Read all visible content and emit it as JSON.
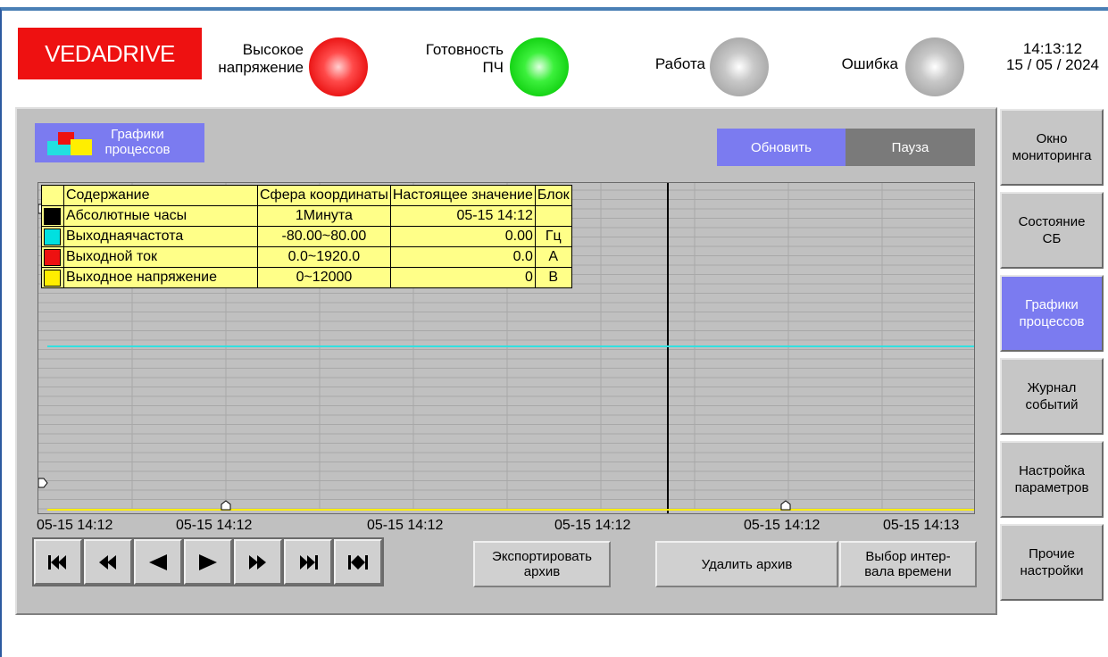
{
  "header": {
    "logo": "VEDADRIVE",
    "indicators": [
      {
        "label_l1": "Высокое",
        "label_l2": "напряжение",
        "state": "red"
      },
      {
        "label_l1": "Готовность",
        "label_l2": "ПЧ",
        "state": "green"
      },
      {
        "label_l1": "Работа",
        "label_l2": "",
        "state": "gray"
      },
      {
        "label_l1": "Ошибка",
        "label_l2": "",
        "state": "gray"
      }
    ],
    "time": "14:13:12",
    "date": "15 / 05 / 2024"
  },
  "page": {
    "title_l1": "Графики",
    "title_l2": "процессов",
    "refresh_label": "Обновить",
    "pause_label": "Пауза"
  },
  "legend": {
    "headers": [
      "Содержание",
      "Сфера координаты",
      "Настоящее значение",
      "Блок"
    ],
    "rows": [
      {
        "color": "#000000",
        "name": "Абсолютные часы",
        "range": "1Минута",
        "value": "05-15 14:12",
        "unit": ""
      },
      {
        "color": "#00e0e0",
        "name": "Выходнаячастота",
        "range": "-80.00~80.00",
        "value": "0.00",
        "unit": "Гц"
      },
      {
        "color": "#ee1111",
        "name": "Выходной ток",
        "range": "0.0~1920.0",
        "value": "0.0",
        "unit": "A"
      },
      {
        "color": "#ffee00",
        "name": "Выходное напряжение",
        "range": "0~12000",
        "value": "0",
        "unit": "B"
      }
    ]
  },
  "x_labels": [
    "05-15 14:12",
    "05-15 14:12",
    "05-15 14:12",
    "05-15 14:12",
    "05-15 14:12",
    "05-15 14:13"
  ],
  "actions": {
    "export_l1": "Экспортировать",
    "export_l2": "архив",
    "delete": "Удалить архив",
    "interval_l1": "Выбор интер-",
    "interval_l2": "вала времени"
  },
  "sidebar": [
    {
      "l1": "Окно",
      "l2": "мониторинга",
      "active": false
    },
    {
      "l1": "Состояние",
      "l2": "СБ",
      "active": false
    },
    {
      "l1": "Графики",
      "l2": "процессов",
      "active": true
    },
    {
      "l1": "Журнал",
      "l2": "событий",
      "active": false
    },
    {
      "l1": "Настройка",
      "l2": "параметров",
      "active": false
    },
    {
      "l1": "Прочие",
      "l2": "настройки",
      "active": false
    }
  ],
  "chart_data": {
    "type": "line",
    "series": [
      {
        "name": "Выходнаячастота",
        "values": [
          0.0,
          0.0
        ],
        "range": [
          -80.0,
          80.0
        ],
        "color": "#33e0e0"
      },
      {
        "name": "Выходное напряжение",
        "values": [
          0,
          0
        ],
        "range": [
          0,
          12000
        ],
        "color": "#ffee00"
      }
    ],
    "grid": true
  }
}
